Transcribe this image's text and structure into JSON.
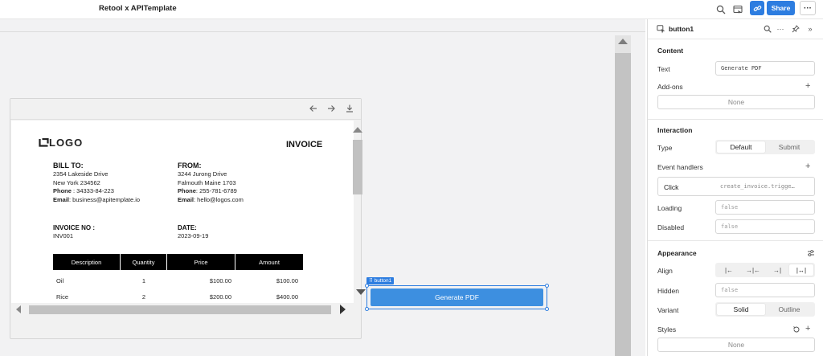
{
  "app": {
    "title": "Retool x APITemplate"
  },
  "topbar": {
    "share_label": "Share",
    "more_label": "···"
  },
  "viewer": {
    "document": {
      "logo_text": "LOGO",
      "heading": "INVOICE",
      "bill_to": {
        "title": "BILL TO:",
        "line1": "2354 Lakeside Drive",
        "line2": "New York 234562",
        "phone_label": "Phone",
        "phone": " : 34333-84-223",
        "email_label": "Email",
        "email": ": business@apitemplate.io"
      },
      "from": {
        "title": "FROM:",
        "line1": "3244 Jurong Drive",
        "line2": "Falmouth Maine 1703",
        "phone_label": "Phone",
        "phone": ": 255-781-6789",
        "email_label": "Email",
        "email": ": hello@logos.com"
      },
      "invoice_no": {
        "title": "INVOICE NO :",
        "value": "INV001"
      },
      "date": {
        "title": "DATE:",
        "value": "2023-09-19"
      },
      "table": {
        "headers": [
          "Description",
          "Quantity",
          "Price",
          "Amount"
        ],
        "rows": [
          [
            "Oil",
            "1",
            "$100.00",
            "$100.00"
          ],
          [
            "Rice",
            "2",
            "$200.00",
            "$400.00"
          ]
        ]
      }
    }
  },
  "component": {
    "tag": "button1",
    "label": "Generate PDF"
  },
  "inspector": {
    "component_name": "button1",
    "content": {
      "title": "Content",
      "text_label": "Text",
      "text_value": "Generate PDF",
      "addons_label": "Add-ons",
      "addons_value": "None"
    },
    "interaction": {
      "title": "Interaction",
      "type_label": "Type",
      "type_options": [
        "Default",
        "Submit"
      ],
      "type_selected": "Default",
      "event_handlers_label": "Event handlers",
      "handler_event": "Click",
      "handler_action": "create_invoice.trigge…",
      "loading_label": "Loading",
      "loading_value": "false",
      "disabled_label": "Disabled",
      "disabled_value": "false"
    },
    "appearance": {
      "title": "Appearance",
      "align_label": "Align",
      "align_options": [
        "|←",
        "→|←",
        "→|",
        "|↔|"
      ],
      "hidden_label": "Hidden",
      "hidden_value": "false",
      "variant_label": "Variant",
      "variant_options": [
        "Solid",
        "Outline"
      ],
      "variant_selected": "Solid",
      "styles_label": "Styles",
      "styles_value": "None"
    }
  },
  "colors": {
    "accent": "#2d7de0",
    "button_fill": "#3d8fe0",
    "table_header": "#000000"
  }
}
